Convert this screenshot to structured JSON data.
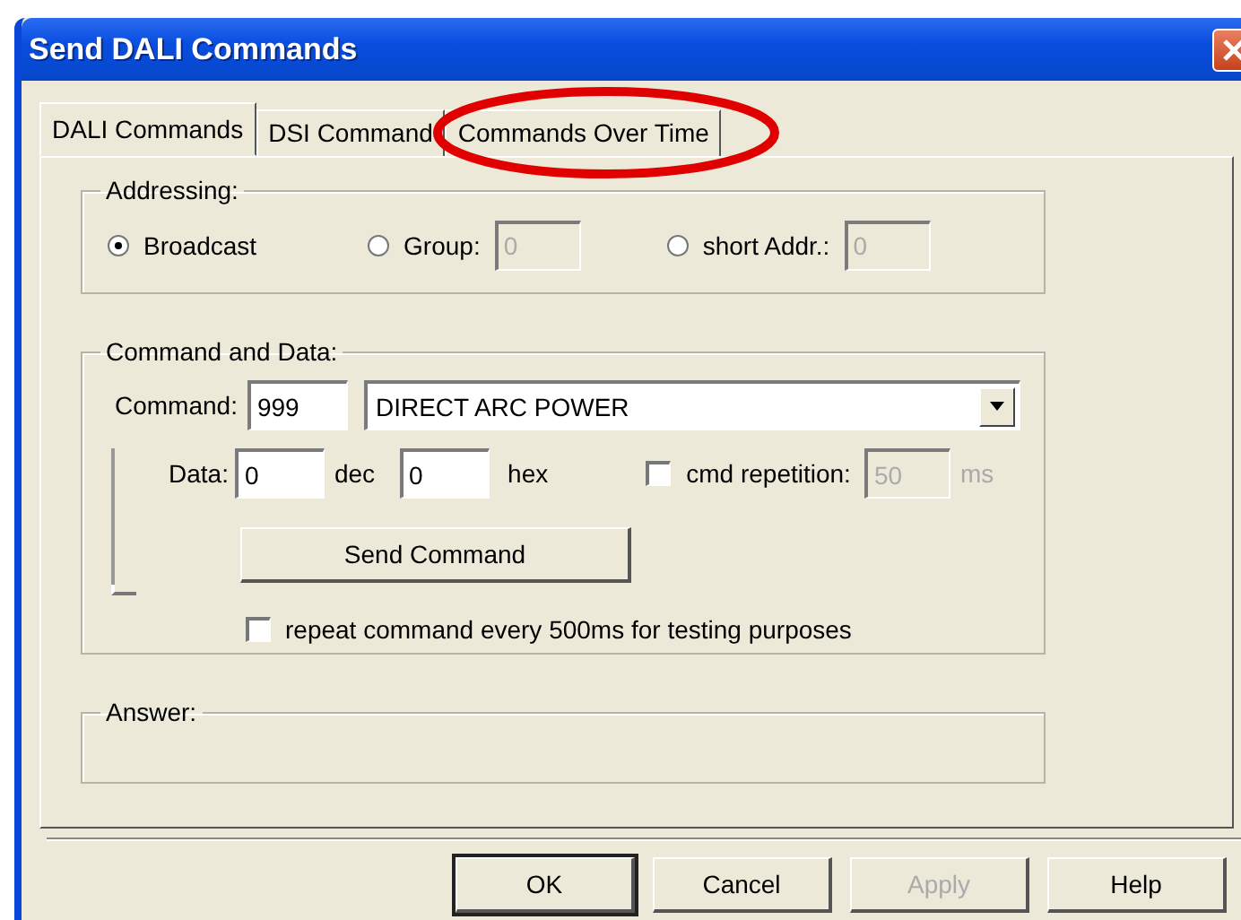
{
  "window": {
    "title": "Send DALI Commands"
  },
  "tabs": [
    {
      "label": "DALI Commands",
      "selected": true,
      "circled": false
    },
    {
      "label": "DSI Command",
      "selected": false,
      "circled": false
    },
    {
      "label": "Commands Over Time",
      "selected": false,
      "circled": true
    }
  ],
  "addressing": {
    "title": "Addressing:",
    "options": [
      {
        "label": "Broadcast",
        "selected": true
      },
      {
        "label": "Group:",
        "selected": false,
        "field": {
          "value": "0",
          "disabled": true
        }
      },
      {
        "label": "short Addr.:",
        "selected": false,
        "field": {
          "value": "0",
          "disabled": true
        }
      }
    ]
  },
  "command_group": {
    "title": "Command and Data:",
    "command_label": "Command:",
    "command_code": "999",
    "command_name": "DIRECT ARC POWER",
    "slider": {
      "level": 0
    },
    "data_label": "Data:",
    "dec_value": "0",
    "dec_unit": "dec",
    "hex_value": "0",
    "hex_unit": "hex",
    "repetition": {
      "label": "cmd repetition:",
      "checked": false,
      "value": "50",
      "unit": "ms",
      "disabled": true
    },
    "send_button": "Send Command",
    "repeat": {
      "label": "repeat command every 500ms for testing purposes",
      "checked": false
    }
  },
  "answer": {
    "title": "Answer:"
  },
  "buttons": [
    {
      "label": "OK",
      "default": true,
      "disabled": false
    },
    {
      "label": "Cancel",
      "default": false,
      "disabled": false
    },
    {
      "label": "Apply",
      "default": false,
      "disabled": true
    },
    {
      "label": "Help",
      "default": false,
      "disabled": false
    }
  ]
}
